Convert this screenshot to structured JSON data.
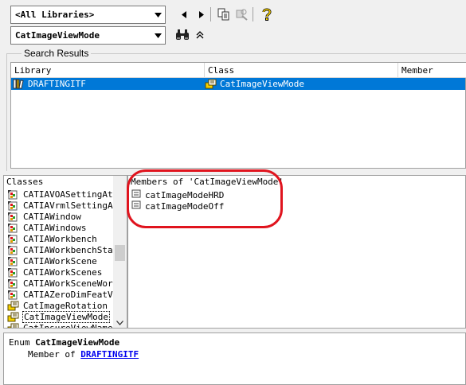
{
  "toolbar": {
    "library_combo": "<All Libraries>",
    "search_combo": "CatImageViewMode",
    "icons": [
      "back-icon",
      "forward-icon",
      "copy-icon",
      "view-definition-icon",
      "help-icon",
      "binoculars-icon",
      "collapse-icon"
    ]
  },
  "search_results": {
    "group_title": "Search Results",
    "columns": [
      "Library",
      "Class",
      "Member"
    ],
    "rows": [
      {
        "library": "DRAFTINGITF",
        "class": "CatImageViewMode",
        "member": ""
      }
    ]
  },
  "classes": {
    "title": "Classes",
    "items": [
      {
        "label": "CATIAVOASettingAtt",
        "icon": "class-icon"
      },
      {
        "label": "CATIAVrmlSettingAtt",
        "icon": "class-icon"
      },
      {
        "label": "CATIAWindow",
        "icon": "class-icon"
      },
      {
        "label": "CATIAWindows",
        "icon": "class-icon"
      },
      {
        "label": "CATIAWorkbench",
        "icon": "class-icon"
      },
      {
        "label": "CATIAWorkbenchStati",
        "icon": "class-icon"
      },
      {
        "label": "CATIAWorkScene",
        "icon": "class-icon"
      },
      {
        "label": "CATIAWorkScenes",
        "icon": "class-icon"
      },
      {
        "label": "CATIAWorkSceneWorkb",
        "icon": "class-icon"
      },
      {
        "label": "CATIAZeroDimFeatVer",
        "icon": "class-icon"
      },
      {
        "label": "CatImageRotation",
        "icon": "enum-icon"
      },
      {
        "label": "CatImageViewMode",
        "icon": "enum-icon",
        "selected": true
      },
      {
        "label": "CatInsureViewNamesl",
        "icon": "enum-icon"
      }
    ]
  },
  "members": {
    "title": "Members of 'CatImageViewMode'",
    "items": [
      {
        "label": "catImageModeHRD",
        "icon": "constant-icon"
      },
      {
        "label": "catImageModeOff",
        "icon": "constant-icon"
      }
    ]
  },
  "details": {
    "kind": "Enum",
    "name": "CatImageViewMode",
    "member_of_prefix": "Member of",
    "library_link": "DRAFTINGITF"
  },
  "colors": {
    "selection": "#0078d7",
    "annotation": "#e0141e",
    "link": "#0000ee"
  }
}
